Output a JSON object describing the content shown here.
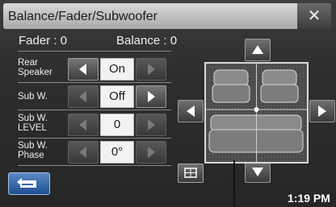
{
  "header": {
    "title": "Balance/Fader/Subwoofer",
    "close_icon": "close-icon"
  },
  "readouts": {
    "fader": "Fader : 0",
    "balance": "Balance : 0"
  },
  "rows": [
    {
      "label_line1": "Rear",
      "label_line2": "Speaker",
      "value": "On"
    },
    {
      "label_line1": "Sub W.",
      "label_line2": "",
      "value": "Off"
    },
    {
      "label_line1": "Sub W.",
      "label_line2": "LEVEL",
      "value": "0"
    },
    {
      "label_line1": "Sub W.",
      "label_line2": "Phase",
      "value": "0°"
    }
  ],
  "icons": {
    "back": "back-arrow-icon",
    "up": "up-arrow-icon",
    "down": "down-arrow-icon",
    "left": "left-arrow-icon",
    "right": "right-arrow-icon",
    "center": "center-position-icon",
    "seats": "car-seat-layout-icon"
  },
  "status": {
    "clock": "1:19 PM"
  }
}
